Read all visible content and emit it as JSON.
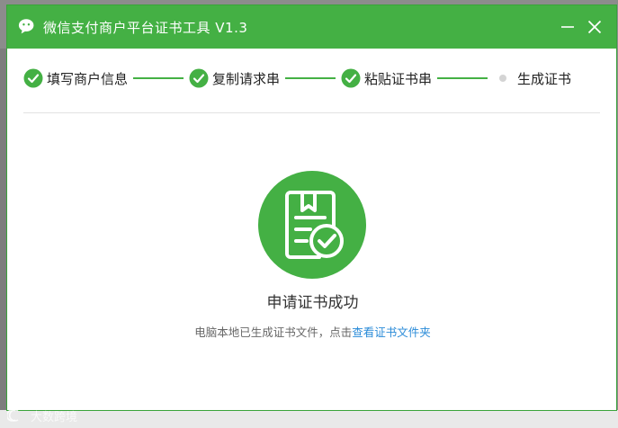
{
  "window": {
    "title": "微信支付商户平台证书工具 V1.3",
    "accent_color": "#44b044"
  },
  "steps": [
    {
      "label": "填写商户信息",
      "status": "done"
    },
    {
      "label": "复制请求串",
      "status": "done"
    },
    {
      "label": "粘贴证书串",
      "status": "done"
    },
    {
      "label": "生成证书",
      "status": "pending"
    }
  ],
  "result": {
    "title": "申请证书成功",
    "desc_prefix": "电脑本地已生成证书文件，点击",
    "link_text": "查看证书文件夹"
  },
  "watermark": {
    "text": "大数跨境"
  },
  "icons": {
    "app": "wechat-logo-icon",
    "minimize": "minimize-icon",
    "close": "close-icon",
    "step_done": "check-circle-icon",
    "hero": "certificate-success-icon"
  }
}
